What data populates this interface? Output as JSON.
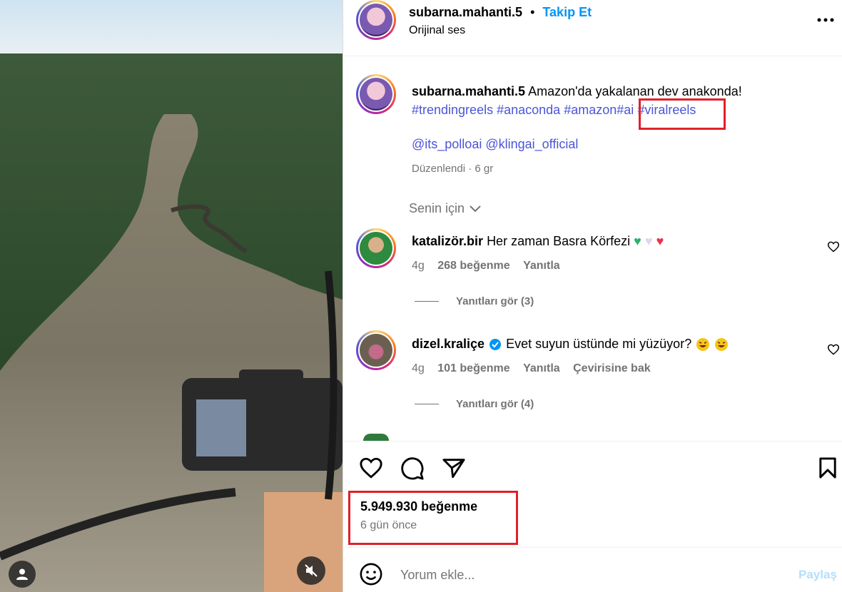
{
  "header": {
    "username": "subarna.mahanti.5",
    "separator": "•",
    "follow_label": "Takip Et",
    "audio_label": "Orijinal ses",
    "more_icon": "more-horizontal-icon"
  },
  "caption": {
    "username": "subarna.mahanti.5",
    "text": "Amazon'da yakalanan dev anakonda!",
    "hashtags": [
      "#trendingreels",
      "#anaconda",
      "#amazon",
      "#ai",
      "#viralreels"
    ],
    "mentions": [
      "@its_polloai",
      "@klingai_official"
    ],
    "edited_label": "Düzenlendi",
    "dot": "·",
    "time": "6 gr"
  },
  "filter": {
    "label": "Senin için",
    "icon": "chevron-down-icon"
  },
  "comments": [
    {
      "username": "katalizör.bir",
      "verified": false,
      "text": "Her zaman Basra Körfezi",
      "emojis": [
        "green-heart",
        "white-heart",
        "red-heart"
      ],
      "time": "4g",
      "likes": "268 beğenme",
      "reply_label": "Yanıtla",
      "translate_label": "",
      "view_replies": "Yanıtları gör (3)"
    },
    {
      "username": "dizel.kraliçe",
      "verified": true,
      "text": "Evet suyun üstünde mi yüzüyor?",
      "emojis": [
        "laughing-face",
        "laughing-face"
      ],
      "time": "4g",
      "likes": "101 beğenme",
      "reply_label": "Yanıtla",
      "translate_label": "Çevirisine bak",
      "view_replies": "Yanıtları gör (4)"
    }
  ],
  "actions": {
    "like_icon": "heart-icon",
    "comment_icon": "comment-icon",
    "share_icon": "send-icon",
    "save_icon": "bookmark-icon"
  },
  "stats": {
    "likes": "5.949.930 beğenme",
    "date": "6 gün önce"
  },
  "comment_box": {
    "placeholder": "Yorum ekle...",
    "post_label": "Paylaş",
    "emoji_icon": "smile-icon"
  },
  "video": {
    "user_icon": "user-icon",
    "mute_icon": "muted-speaker-icon"
  },
  "colors": {
    "link": "#0095f6",
    "hashtag": "#4a55d8",
    "annotation": "#e0202a",
    "heart": "#ed4956"
  }
}
